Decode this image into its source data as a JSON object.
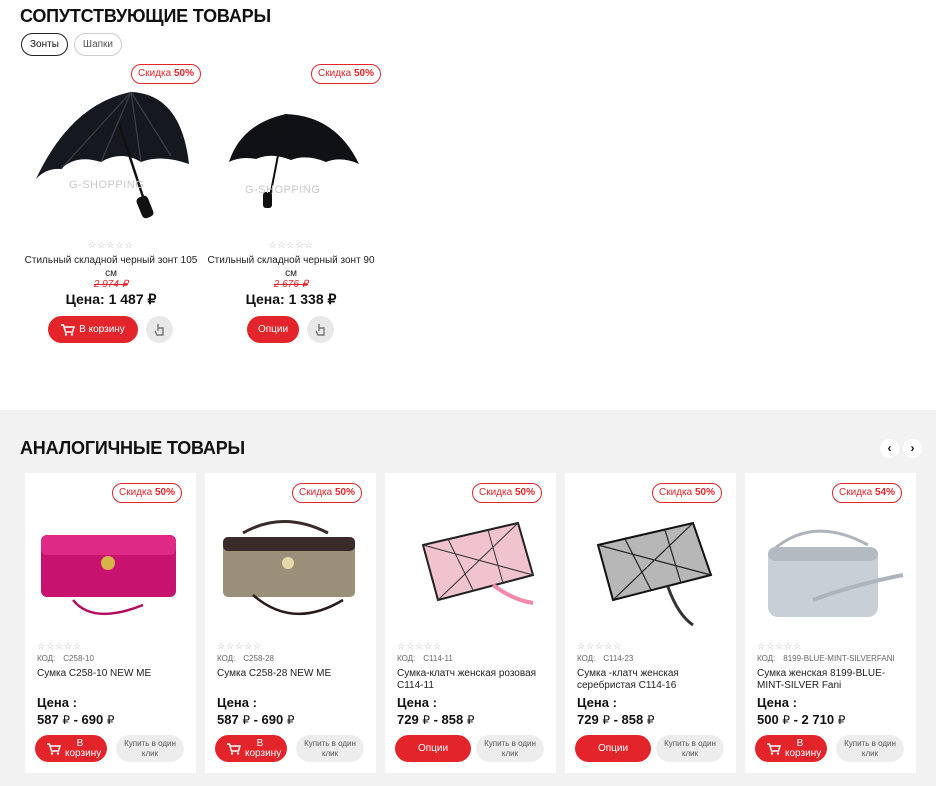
{
  "related": {
    "title": "СОПУТСТВУЮЩИЕ ТОВАРЫ",
    "tabs": [
      "Зонты",
      "Шапки"
    ],
    "products": [
      {
        "badge_prefix": "Скидка",
        "badge_value": "50%",
        "watermark": "G-SHOPPING",
        "stars": "☆☆☆☆☆",
        "name": "Стильный складной черный зонт 105 см",
        "old_price": "2 974 ₽",
        "price": "Цена: 1 487 ₽",
        "button": "В корзину"
      },
      {
        "badge_prefix": "Скидка",
        "badge_value": "50%",
        "watermark": "G-SHOPPING",
        "stars": "☆☆☆☆☆",
        "name": "Стильный складной черный зонт 90 см",
        "old_price": "2 676 ₽",
        "price": "Цена: 1 338 ₽",
        "button": "Опции"
      }
    ]
  },
  "analog": {
    "title": "АНАЛОГИЧНЫЕ ТОВАРЫ",
    "prev_icon": "‹",
    "next_icon": "›",
    "products": [
      {
        "badge_prefix": "Скидка",
        "badge_value": "50%",
        "stars": "☆☆☆☆☆",
        "code_label": "КОД:",
        "code": "C258-10",
        "name": "Сумка C258-10 NEW ME",
        "price_label": "Цена :",
        "price_from": "587",
        "price_to": "690",
        "currency": "₽",
        "button": "В корзину",
        "one_click": "Купить в один клик",
        "color": "#c8126f"
      },
      {
        "badge_prefix": "Скидка",
        "badge_value": "50%",
        "stars": "☆☆☆☆☆",
        "code_label": "КОД:",
        "code": "C258-28",
        "name": "Сумка C258-28 NEW ME",
        "price_label": "Цена :",
        "price_from": "587",
        "price_to": "690",
        "currency": "₽",
        "button": "В корзину",
        "one_click": "Купить в один клик",
        "color": "#9a8f78"
      },
      {
        "badge_prefix": "Скидка",
        "badge_value": "50%",
        "stars": "☆☆☆☆☆",
        "code_label": "КОД:",
        "code": "C114-11",
        "name": "Сумка-клатч женская розовая C114-11",
        "price_label": "Цена :",
        "price_from": "729",
        "price_to": "858",
        "currency": "₽",
        "button": "Опции",
        "one_click": "Купить в один клик",
        "color": "#f0c3cf"
      },
      {
        "badge_prefix": "Скидка",
        "badge_value": "50%",
        "stars": "☆☆☆☆☆",
        "code_label": "КОД:",
        "code": "C114-23",
        "name": "Сумка -клатч женская серебристая C114-16",
        "price_label": "Цена :",
        "price_from": "729",
        "price_to": "858",
        "currency": "₽",
        "button": "Опции",
        "one_click": "Купить в один клик",
        "color": "#b7b7b7"
      },
      {
        "badge_prefix": "Скидка",
        "badge_value": "54%",
        "stars": "☆☆☆☆☆",
        "code_label": "КОД:",
        "code": "8199-BLUE-MINT-SILVERFANI",
        "name": "Сумка женская 8199-BLUE-MINT-SILVER Fani",
        "price_label": "Цена :",
        "price_from": "500",
        "price_to": "2 710",
        "currency": "₽",
        "button": "В корзину",
        "one_click": "Купить в один клик",
        "color": "#c9cfd6"
      }
    ]
  }
}
